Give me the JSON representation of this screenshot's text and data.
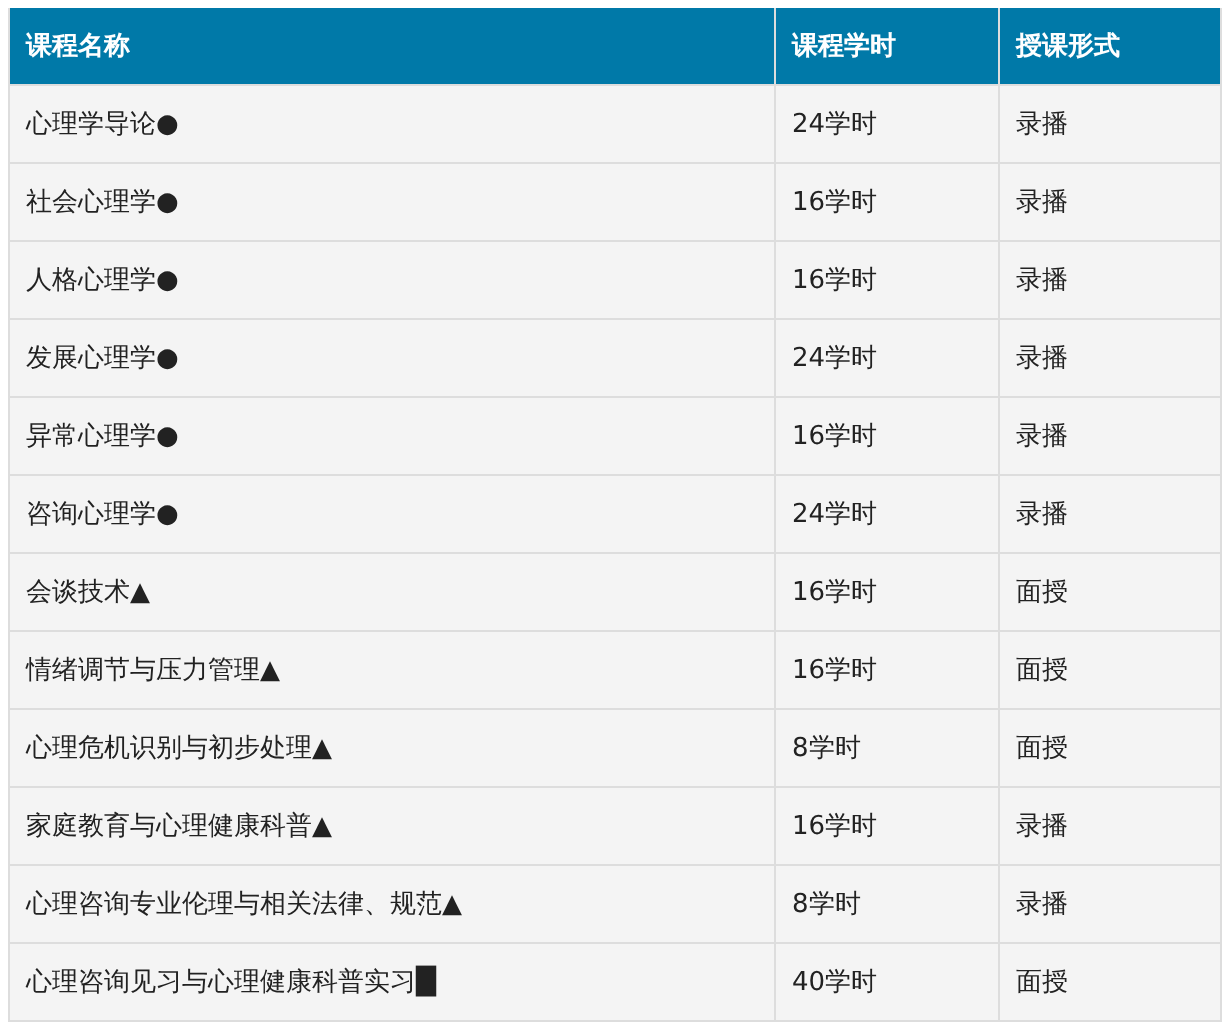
{
  "table": {
    "columns": [
      "课程名称",
      "课程学时",
      "授课形式"
    ],
    "rows": [
      [
        "心理学导论●",
        "24学时",
        "录播"
      ],
      [
        "社会心理学●",
        "16学时",
        "录播"
      ],
      [
        "人格心理学●",
        "16学时",
        "录播"
      ],
      [
        "发展心理学●",
        "24学时",
        "录播"
      ],
      [
        "异常心理学●",
        "16学时",
        "录播"
      ],
      [
        "咨询心理学●",
        "24学时",
        "录播"
      ],
      [
        "会谈技术▲",
        "16学时",
        "面授"
      ],
      [
        "情绪调节与压力管理▲",
        "16学时",
        "面授"
      ],
      [
        "心理危机识别与初步处理▲",
        "8学时",
        "面授"
      ],
      [
        "家庭教育与心理健康科普▲",
        "16学时",
        "录播"
      ],
      [
        "心理咨询专业伦理与相关法律、规范▲",
        "8学时",
        "录播"
      ],
      [
        "心理咨询见习与心理健康科普实习█",
        "40学时",
        "面授"
      ]
    ]
  }
}
